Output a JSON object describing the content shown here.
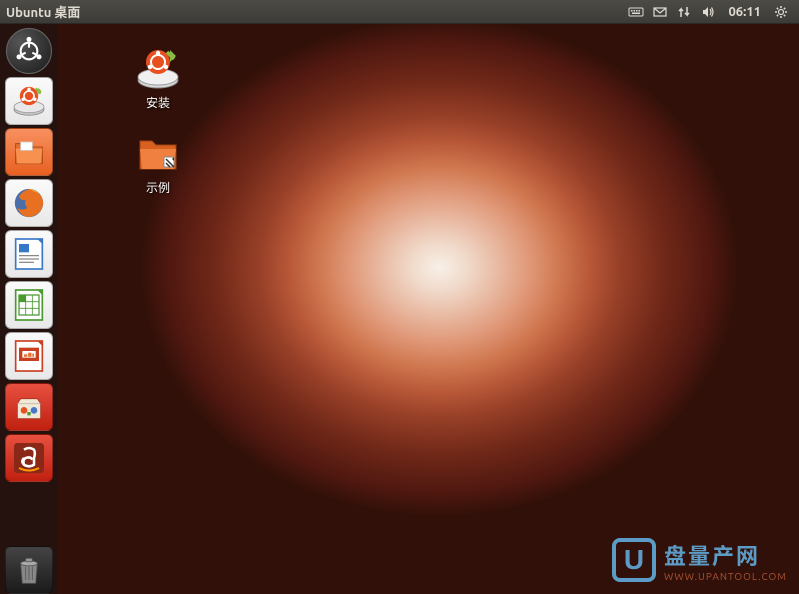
{
  "topbar": {
    "title": "Ubuntu 桌面",
    "time": "06:11"
  },
  "launcher": {
    "items": [
      {
        "name": "dash",
        "label": "Dash"
      },
      {
        "name": "installer",
        "label": "安装"
      },
      {
        "name": "files",
        "label": "文件"
      },
      {
        "name": "firefox",
        "label": "Firefox"
      },
      {
        "name": "writer",
        "label": "LibreOffice Writer"
      },
      {
        "name": "calc",
        "label": "LibreOffice Calc"
      },
      {
        "name": "impress",
        "label": "LibreOffice Impress"
      },
      {
        "name": "software",
        "label": "Ubuntu 软件中心"
      },
      {
        "name": "amazon",
        "label": "Amazon"
      },
      {
        "name": "trash",
        "label": "回收站"
      }
    ]
  },
  "desktop": {
    "icons": [
      {
        "name": "install",
        "label": "安装"
      },
      {
        "name": "examples",
        "label": "示例"
      }
    ]
  },
  "watermark": {
    "logo": "U",
    "text": "盘量产网",
    "url": "WWW.UPANTOOL.COM"
  }
}
